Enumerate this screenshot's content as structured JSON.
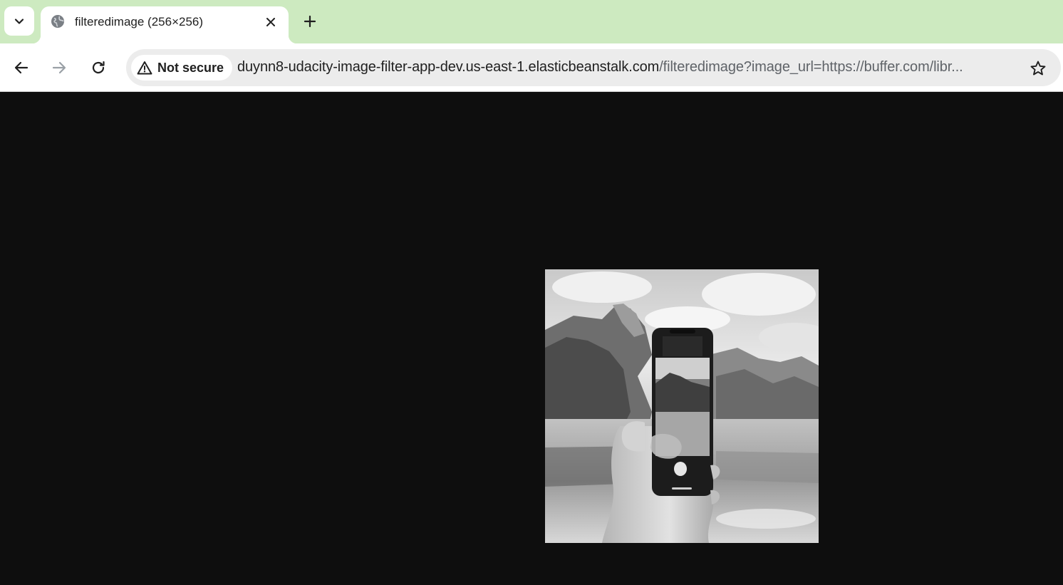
{
  "browser": {
    "tab": {
      "title": "filteredimage (256×256)",
      "favicon": "globe-icon",
      "close_icon": "close-icon"
    },
    "new_tab_icon": "plus-icon",
    "tab_search_icon": "chevron-down-icon",
    "nav": {
      "back_icon": "arrow-left-icon",
      "forward_icon": "arrow-right-icon",
      "reload_icon": "reload-icon"
    },
    "omnibox": {
      "security_label": "Not secure",
      "security_icon": "warning-triangle-icon",
      "url_host": "duynn8-udacity-image-filter-app-dev.us-east-1.elasticbeanstalk.com",
      "url_rest": "/filteredimage?image_url=https://buffer.com/libr...",
      "bookmark_icon": "star-icon"
    }
  },
  "page": {
    "image": {
      "description_icon": "grayscale-photo",
      "natural_size": "256×256"
    }
  },
  "colors": {
    "tabstrip_bg": "#cdeac0",
    "page_bg": "#0e0e0e",
    "omnibox_bg": "#ececec"
  }
}
